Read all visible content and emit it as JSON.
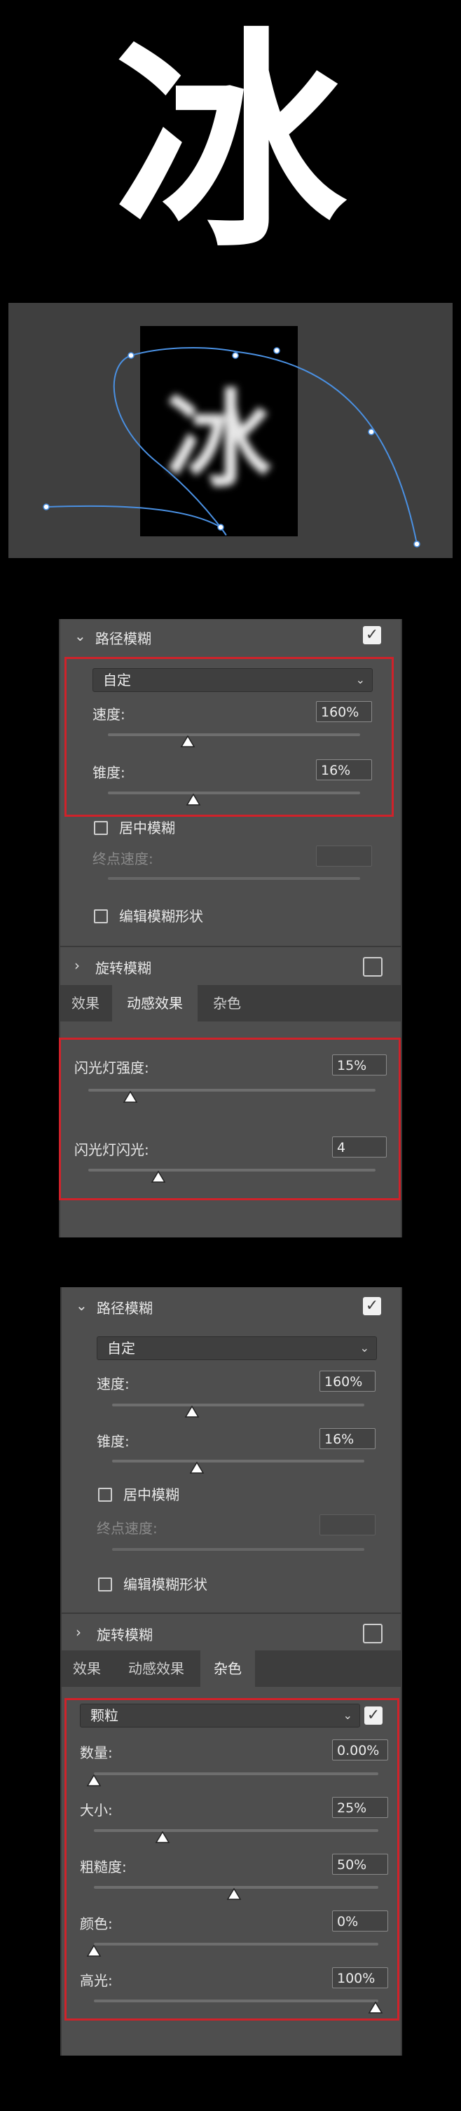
{
  "hero": {
    "glyph": "冰"
  },
  "canvas": {
    "glyph": "冰"
  },
  "panel1": {
    "path_blur": {
      "title": "路径模糊",
      "enabled": true,
      "preset": "自定",
      "speed_label": "速度:",
      "speed_value": "160%",
      "speed_level": 0.32,
      "taper_label": "锥度:",
      "taper_value": "16%",
      "taper_level": 0.34,
      "center_blur_label": "居中模糊",
      "end_speed_label": "终点速度:",
      "edit_shape_label": "编辑模糊形状"
    },
    "spin_blur": {
      "title": "旋转模糊",
      "enabled": false
    },
    "tabs": [
      "效果",
      "动感效果",
      "杂色"
    ],
    "active_tab": "动感效果",
    "motion": {
      "strobe_strength_label": "闪光灯强度:",
      "strobe_strength_value": "15%",
      "strobe_strength_level": 0.15,
      "strobe_flashes_label": "闪光灯闪光:",
      "strobe_flashes_value": "4",
      "strobe_flashes_level": 0.24
    }
  },
  "panel2": {
    "path_blur": {
      "title": "路径模糊",
      "enabled": true,
      "preset": "自定",
      "speed_label": "速度:",
      "speed_value": "160%",
      "speed_level": 0.32,
      "taper_label": "锥度:",
      "taper_value": "16%",
      "taper_level": 0.34,
      "center_blur_label": "居中模糊",
      "end_speed_label": "终点速度:",
      "edit_shape_label": "编辑模糊形状"
    },
    "spin_blur": {
      "title": "旋转模糊",
      "enabled": false
    },
    "tabs": [
      "效果",
      "动感效果",
      "杂色"
    ],
    "active_tab": "杂色",
    "noise": {
      "type": "颗粒",
      "enabled": true,
      "amount_label": "数量:",
      "amount_value": "0.00%",
      "amount_level": 0.0,
      "size_label": "大小:",
      "size_value": "25%",
      "size_level": 0.24,
      "roughness_label": "粗糙度:",
      "roughness_value": "50%",
      "roughness_level": 0.5,
      "color_label": "颜色:",
      "color_value": "0%",
      "color_level": 0.0,
      "highlights_label": "高光:",
      "highlights_value": "100%",
      "highlights_level": 1.0
    }
  },
  "colors": {
    "accent_red": "#d0222a",
    "path_blue": "#4a90e2",
    "panel_bg": "#4e4e4e"
  },
  "icons": {
    "checkbox": "checkmark-icon",
    "collapse": "chevron-down-icon",
    "expand": "chevron-right-icon",
    "dropdown": "chevron-down-icon",
    "slider": "slider-thumb-icon"
  }
}
